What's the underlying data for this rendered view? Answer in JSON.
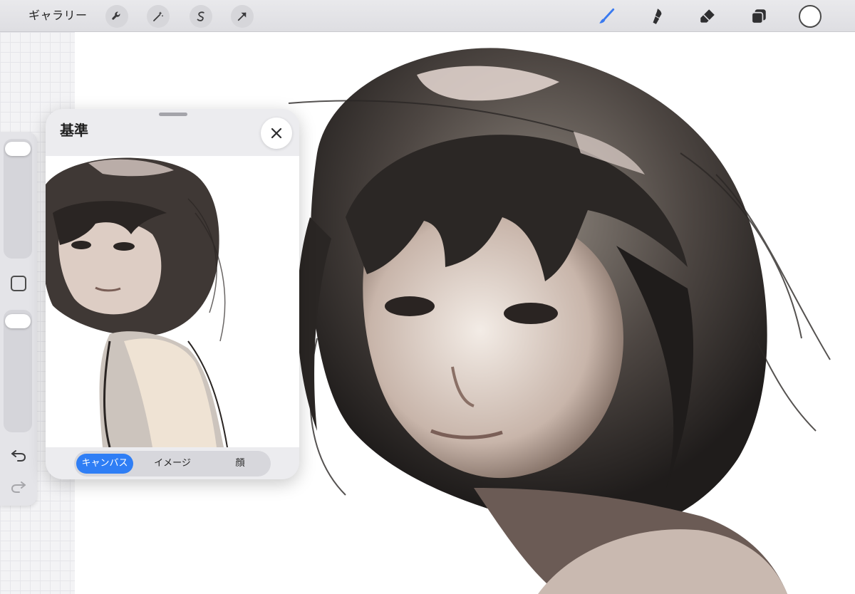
{
  "toolbar": {
    "gallery_label": "ギャラリー",
    "left_tools": [
      "wrench-icon",
      "magic-wand-icon",
      "selection-icon",
      "transform-arrow-icon"
    ],
    "right_tools": [
      "brush-icon",
      "smudge-icon",
      "eraser-icon",
      "layers-icon"
    ],
    "brush_accent": "#3a7af0",
    "current_color": "#ffffff"
  },
  "sidebar": {
    "brush_size_slider_level": 0.08,
    "opacity_slider_level": 0.05
  },
  "reference": {
    "title": "基準",
    "tabs": [
      {
        "label": "キャンバス",
        "active": true
      },
      {
        "label": "イメージ",
        "active": false
      },
      {
        "label": "顔",
        "active": false
      }
    ],
    "active_color": "#2f7ef5"
  }
}
